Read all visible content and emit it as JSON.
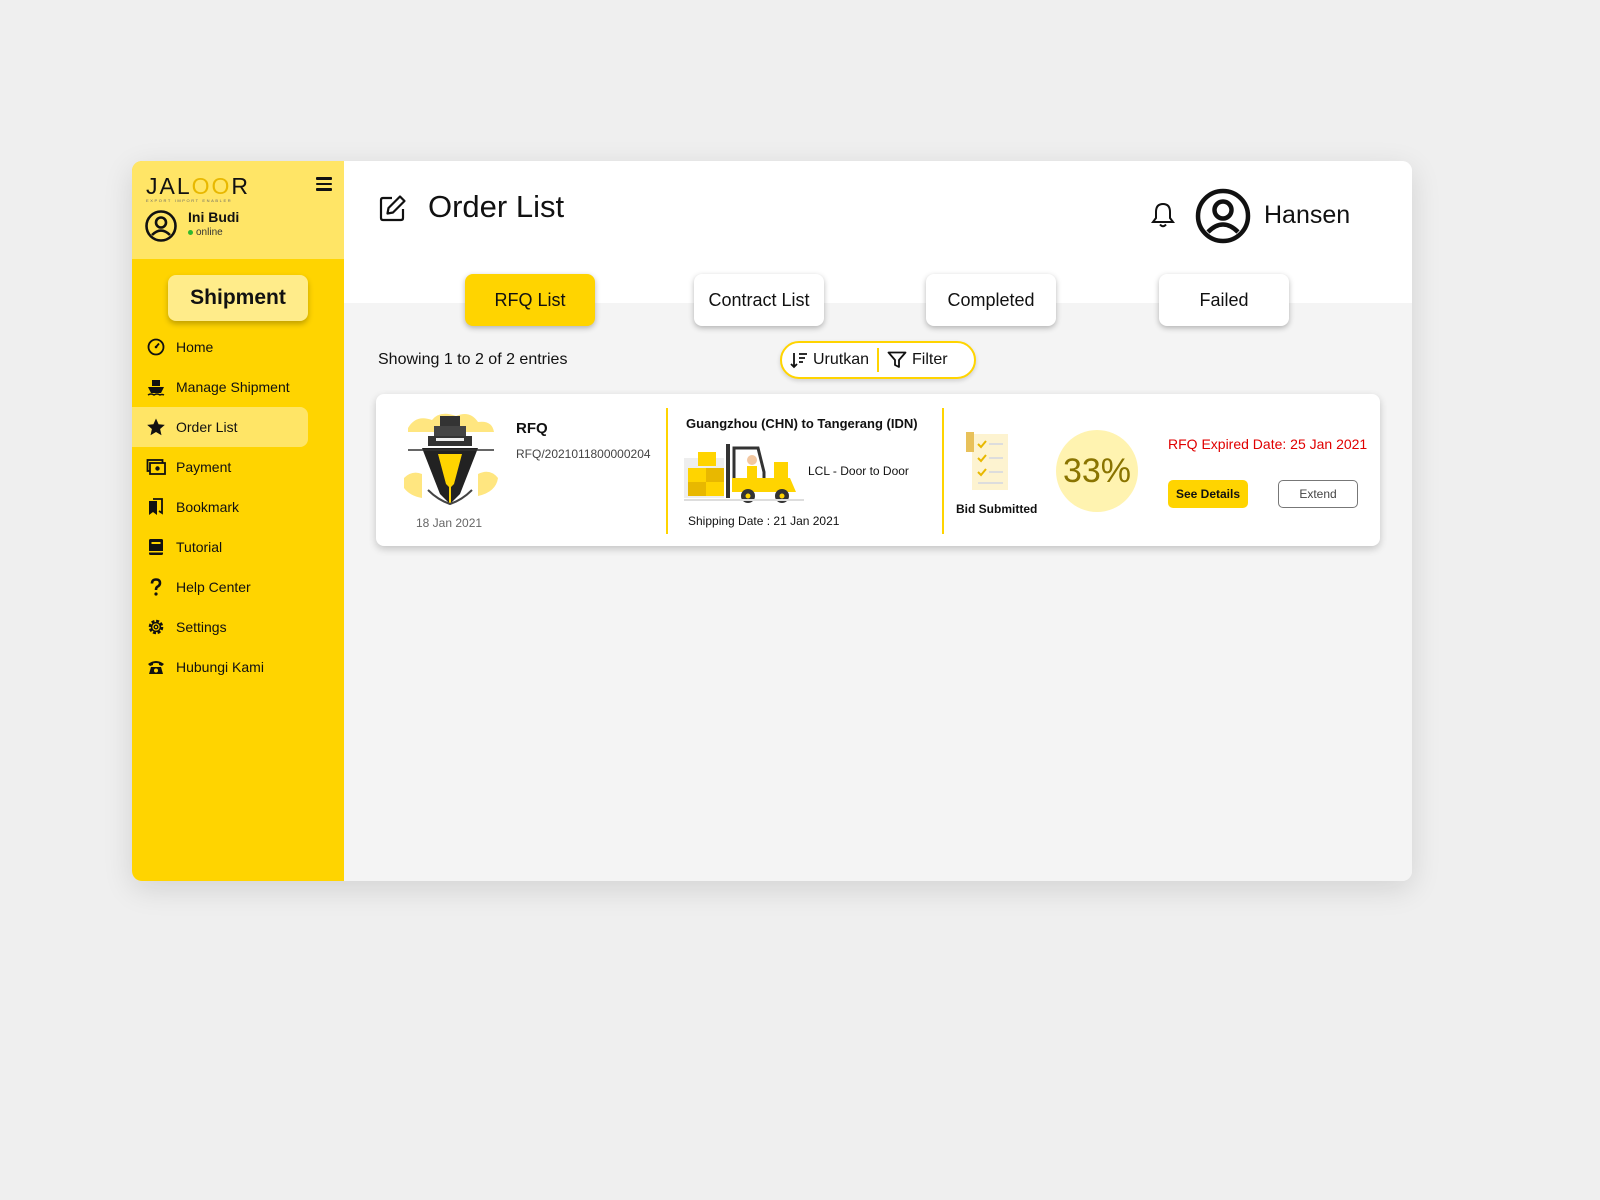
{
  "brand": {
    "logo_main": "JAL",
    "logo_gold": "OO",
    "logo_end": "R",
    "logo_sub": "EXPORT IMPORT ENABLER"
  },
  "sidebar_user": {
    "name": "Ini Budi",
    "status": "online"
  },
  "sidebar": {
    "section_button": "Shipment",
    "items": [
      {
        "label": "Home",
        "icon": "speedometer-icon"
      },
      {
        "label": "Manage Shipment",
        "icon": "ship-icon"
      },
      {
        "label": "Order List",
        "icon": "star-icon"
      },
      {
        "label": "Payment",
        "icon": "payment-icon"
      },
      {
        "label": "Bookmark",
        "icon": "bookmark-icon"
      },
      {
        "label": "Tutorial",
        "icon": "book-icon"
      },
      {
        "label": "Help Center",
        "icon": "question-icon"
      },
      {
        "label": "Settings",
        "icon": "gear-icon"
      },
      {
        "label": "Hubungi Kami",
        "icon": "phone-icon"
      }
    ],
    "active_index": 2
  },
  "header": {
    "title": "Order List",
    "user_name": "Hansen"
  },
  "tabs": [
    {
      "label": "RFQ List",
      "active": true
    },
    {
      "label": "Contract List",
      "active": false
    },
    {
      "label": "Completed",
      "active": false
    },
    {
      "label": "Failed",
      "active": false
    }
  ],
  "entries_text": "Showing 1 to 2 of 2 entries",
  "toolbar": {
    "sort_label": "Urutkan",
    "filter_label": "Filter"
  },
  "order_card": {
    "type": "RFQ",
    "code": "RFQ/2021011800000204",
    "created_date": "18 Jan 2021",
    "route": "Guangzhou (CHN) to Tangerang (IDN)",
    "service": "LCL - Door to Door",
    "shipping_date": "Shipping Date : 21 Jan 2021",
    "status": "Bid Submitted",
    "progress": "33%",
    "expired": "RFQ Expired Date: 25 Jan 2021",
    "see_details_label": "See Details",
    "extend_label": "Extend"
  },
  "colors": {
    "accent": "#ffd400",
    "accent_light": "#ffe566",
    "danger": "#e00000",
    "bg": "#efefef"
  }
}
